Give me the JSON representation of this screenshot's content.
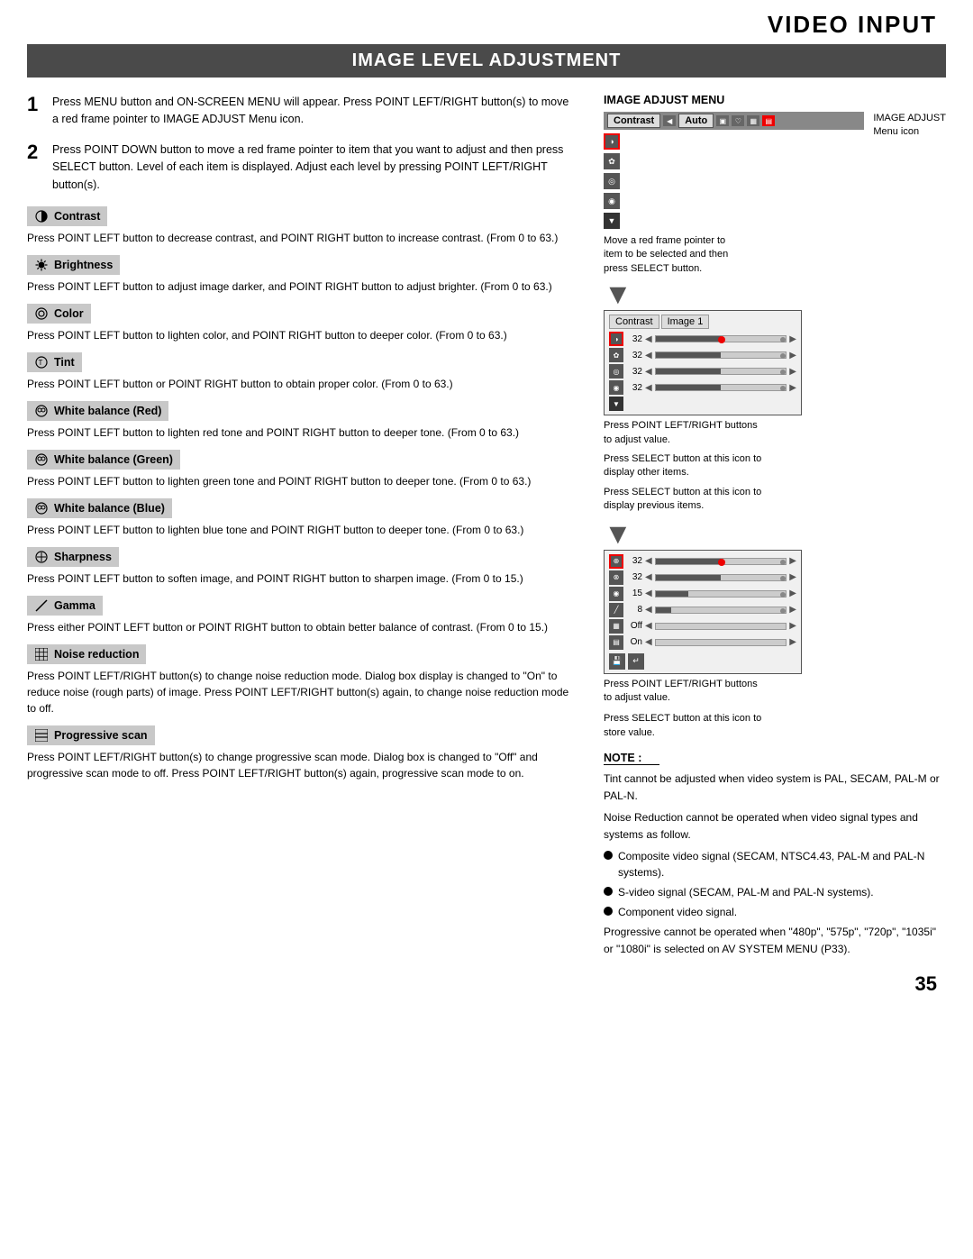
{
  "page": {
    "title": "VIDEO INPUT",
    "section_title": "IMAGE LEVEL ADJUSTMENT",
    "page_number": "35"
  },
  "steps": [
    {
      "number": "1",
      "text": "Press MENU button and ON-SCREEN MENU will appear.  Press POINT LEFT/RIGHT button(s) to move a red frame pointer to IMAGE ADJUST Menu icon."
    },
    {
      "number": "2",
      "text": "Press POINT DOWN button to move a red frame pointer to item that you want to adjust and then press SELECT button.  Level of each item is displayed.  Adjust each level by pressing POINT LEFT/RIGHT button(s)."
    }
  ],
  "features": [
    {
      "id": "contrast",
      "label": "Contrast",
      "icon": "half-circle",
      "desc": "Press POINT LEFT button to decrease contrast, and POINT RIGHT button to increase contrast.  (From 0 to 63.)"
    },
    {
      "id": "brightness",
      "label": "Brightness",
      "icon": "sun",
      "desc": "Press POINT LEFT button to adjust image darker, and POINT RIGHT button to adjust brighter.  (From 0 to 63.)"
    },
    {
      "id": "color",
      "label": "Color",
      "icon": "circle-c",
      "desc": "Press POINT LEFT button to lighten color, and POINT RIGHT button to deeper color.  (From 0 to 63.)"
    },
    {
      "id": "tint",
      "label": "Tint",
      "icon": "circle-t",
      "desc": "Press POINT LEFT button or POINT RIGHT button to obtain proper color.  (From 0 to 63.)"
    },
    {
      "id": "white-balance-red",
      "label": "White balance (Red)",
      "icon": "wb",
      "desc": "Press POINT LEFT button to lighten red tone and POINT RIGHT button to deeper tone.  (From 0 to 63.)"
    },
    {
      "id": "white-balance-green",
      "label": "White balance (Green)",
      "icon": "wb",
      "desc": "Press POINT LEFT button to lighten green tone and POINT RIGHT button to deeper tone.  (From 0 to 63.)"
    },
    {
      "id": "white-balance-blue",
      "label": "White balance (Blue)",
      "icon": "wb",
      "desc": "Press POINT LEFT button to lighten blue tone and POINT RIGHT button to deeper tone.  (From 0 to 63.)"
    },
    {
      "id": "sharpness",
      "label": "Sharpness",
      "icon": "diamond",
      "desc": "Press POINT LEFT button to soften image, and POINT RIGHT button to sharpen image.  (From 0 to 15.)"
    },
    {
      "id": "gamma",
      "label": "Gamma",
      "icon": "diagonal",
      "desc": "Press either POINT LEFT button or POINT RIGHT button to obtain better balance of contrast.  (From 0 to 15.)"
    },
    {
      "id": "noise-reduction",
      "label": "Noise reduction",
      "icon": "grid",
      "desc": "Press POINT LEFT/RIGHT button(s) to change noise reduction mode. Dialog box display is changed to \"On\" to reduce noise (rough parts) of image.  Press POINT LEFT/RIGHT button(s) again, to change noise reduction mode to off."
    },
    {
      "id": "progressive-scan",
      "label": "Progressive scan",
      "icon": "lines",
      "desc": "Press POINT LEFT/RIGHT button(s) to change progressive scan mode.  Dialog box is changed to \"Off\" and progressive scan mode to off.  Press POINT LEFT/RIGHT button(s) again, progressive scan mode to on."
    }
  ],
  "right_panel": {
    "menu_title": "IMAGE ADJUST MENU",
    "menu_icon_label": "IMAGE ADJUST\nMenu icon",
    "annotation1": "Move a red frame pointer to\nitem to be selected and then\npress SELECT button.",
    "annotation2": "Press POINT LEFT/RIGHT buttons\nto adjust value.",
    "annotation3": "Press SELECT button at this icon to\ndisplay other items.",
    "annotation4": "Press SELECT button at this icon to\ndisplay previous items.",
    "annotation5": "Press POINT LEFT/RIGHT buttons\nto adjust value.",
    "annotation6": "Press SELECT button at this icon to\nstore value.",
    "top_menu": {
      "tab1": "Contrast",
      "tab2": "Auto"
    },
    "mid_menu": {
      "tab1": "Contrast",
      "tab2": "Image 1"
    },
    "sliders": [
      {
        "val": "32",
        "filled": 50
      },
      {
        "val": "32",
        "filled": 50
      },
      {
        "val": "32",
        "filled": 50
      },
      {
        "val": "32",
        "filled": 50
      }
    ],
    "bottom_sliders": [
      {
        "val": "32",
        "filled": 50
      },
      {
        "val": "32",
        "filled": 50
      },
      {
        "val": "15",
        "filled": 25
      },
      {
        "val": "8",
        "filled": 12
      },
      {
        "val": "Off",
        "filled": 0
      },
      {
        "val": "On",
        "filled": 0
      }
    ]
  },
  "note": {
    "title": "NOTE :",
    "text1": "Tint cannot be adjusted when video system is PAL, SECAM, PAL-M or PAL-N.",
    "text2": "Noise Reduction cannot be operated when video signal types and systems as follow.",
    "bullets": [
      "Composite video signal (SECAM, NTSC4.43, PAL-M and PAL-N systems).",
      "S-video signal (SECAM, PAL-M and PAL-N systems).",
      "Component video signal."
    ],
    "text3": "Progressive cannot be operated when \"480p\", \"575p\", \"720p\", \"1035i\" or \"1080i\" is selected on AV SYSTEM MENU (P33)."
  }
}
